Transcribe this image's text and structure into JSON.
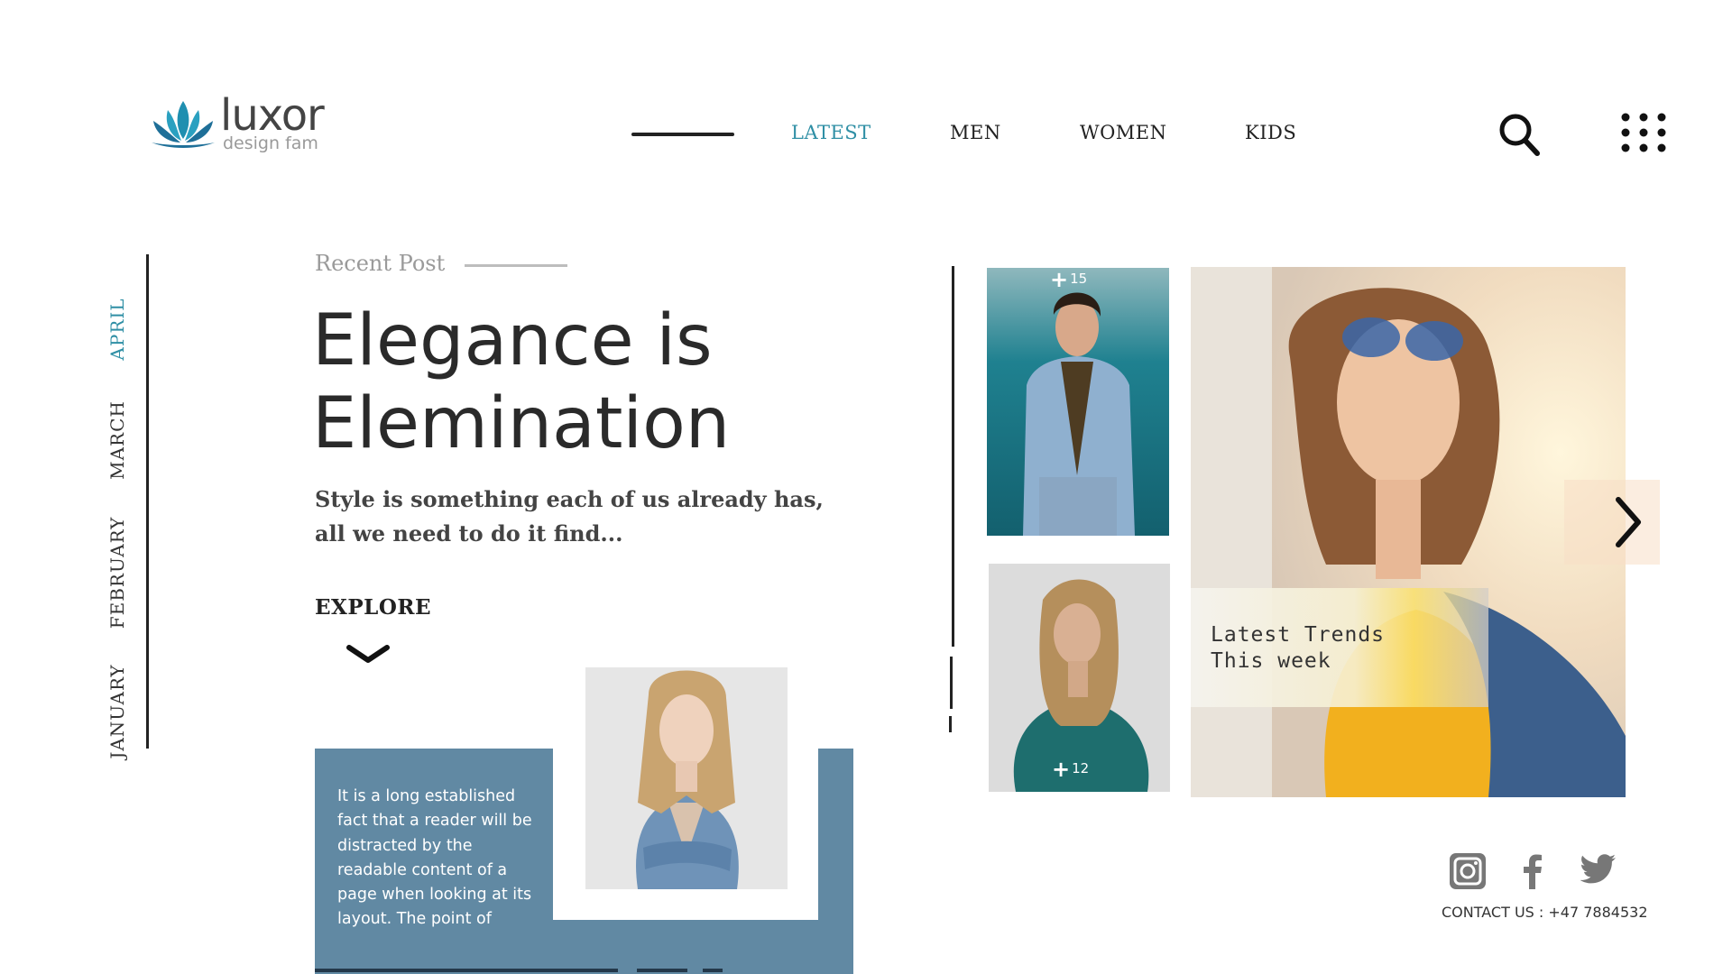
{
  "brand": {
    "name": "luxor",
    "tagline": "design fam",
    "logo_icon": "lotus-icon",
    "accent_color": "#2f8fa5"
  },
  "nav": {
    "items": [
      {
        "label": "LATEST",
        "active": true
      },
      {
        "label": "MEN",
        "active": false
      },
      {
        "label": "WOMEN",
        "active": false
      },
      {
        "label": "KIDS",
        "active": false
      }
    ],
    "search_icon": "search-icon",
    "menu_icon": "grid-dots-icon"
  },
  "months": [
    {
      "label": "APRIL",
      "active": true
    },
    {
      "label": "MARCH",
      "active": false
    },
    {
      "label": "FEBRUARY",
      "active": false
    },
    {
      "label": "JANUARY",
      "active": false
    }
  ],
  "hero": {
    "recent_label": "Recent Post",
    "title_line1": "Elegance is",
    "title_line2": "Elemination",
    "subtitle_line1": "Style is something each of us already has,",
    "subtitle_line2": "all we need to do it find...",
    "explore_label": "EXPLORE",
    "explore_icon": "chevron-down-icon"
  },
  "card": {
    "color": "#6189a3",
    "text": "It is a long established fact that a reader will be distracted by the readable content of a page when looking at its layout. The point of"
  },
  "gallery": {
    "man_photo_count": "15",
    "woman_photo_count": "12",
    "count_icon": "plus-icon",
    "trend_line1": "Latest Trends",
    "trend_line2": "This week",
    "next_icon": "chevron-right-icon"
  },
  "footer": {
    "social": [
      "instagram-icon",
      "facebook-icon",
      "twitter-icon"
    ],
    "contact": "CONTACT US : +47 7884532"
  }
}
